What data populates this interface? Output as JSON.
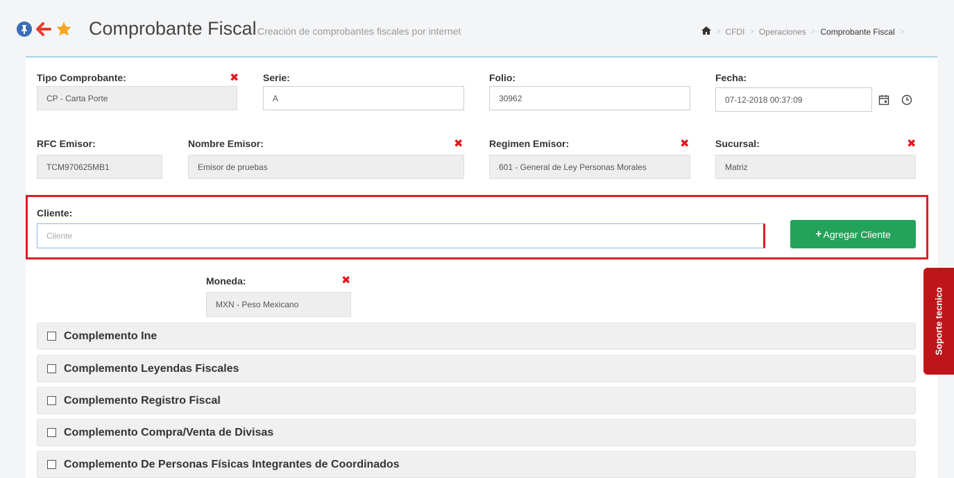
{
  "header": {
    "title": "Comprobante Fiscal",
    "subtitle": "Creación de comprobantes fiscales por internet",
    "breadcrumb": [
      "CFDI",
      "Operaciones",
      "Comprobante Fiscal"
    ]
  },
  "form": {
    "tipo_comprobante": {
      "label": "Tipo Comprobante:",
      "value": "CP - Carta Porte"
    },
    "serie": {
      "label": "Serie:",
      "value": "A"
    },
    "folio": {
      "label": "Folio:",
      "value": "30962"
    },
    "fecha": {
      "label": "Fecha:",
      "value": "07-12-2018 00:37:09"
    },
    "rfc_emisor": {
      "label": "RFC Emisor:",
      "value": "TCM970625MB1"
    },
    "nombre_emisor": {
      "label": "Nombre Emisor:",
      "value": "Emisor de pruebas"
    },
    "regimen_emisor": {
      "label": "Regimen Emisor:",
      "value": "601 - General de Ley Personas Morales"
    },
    "sucursal": {
      "label": "Sucursal:",
      "value": "Matriz"
    },
    "cliente": {
      "label": "Cliente:",
      "placeholder": "Cliente",
      "value": ""
    },
    "add_client_label": "Agregar Cliente",
    "moneda": {
      "label": "Moneda:",
      "value": "MXN - Peso Mexicano"
    }
  },
  "complementos": [
    "Complemento Ine",
    "Complemento Leyendas Fiscales",
    "Complemento Registro Fiscal",
    "Complemento Compra/Venta de Divisas",
    "Complemento De Personas Físicas Integrantes de Coordinados"
  ],
  "support_tab": "Soporte tecnico",
  "colors": {
    "accent_blue": "#3a6fb8",
    "arrow_red": "#e53c2f",
    "star_orange": "#f5a623",
    "clear_x": "#e0191f",
    "highlight_red": "#d81f26",
    "button_green": "#23a35a",
    "support_red": "#c0141b"
  },
  "icons": [
    "pin-icon",
    "back-arrow-icon",
    "favorite-star-icon",
    "home-icon",
    "clear-icon",
    "calendar-icon",
    "clock-icon",
    "plus-icon",
    "checkbox-icon"
  ]
}
